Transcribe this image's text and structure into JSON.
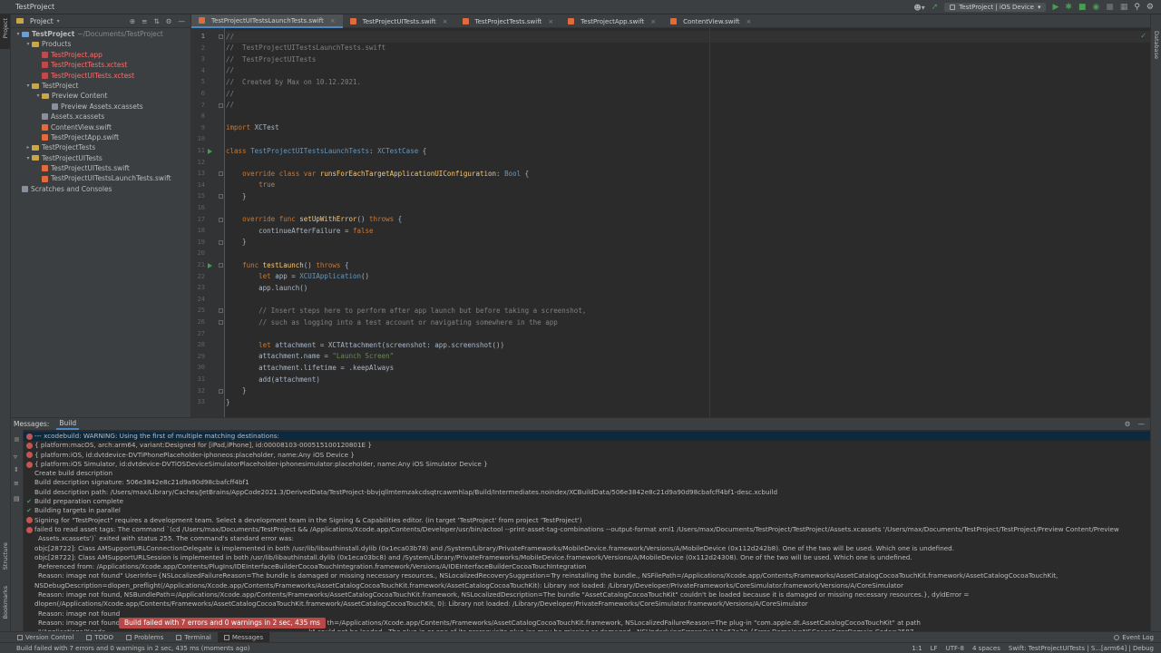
{
  "window": {
    "title": "TestProject"
  },
  "toolbar": {
    "run_config": "TestProject | iOS Device"
  },
  "project_panel": {
    "title": "Project",
    "tree": [
      {
        "depth": 0,
        "kind": "root",
        "label": "TestProject",
        "extra": "~/Documents/TestProject",
        "open": true
      },
      {
        "depth": 1,
        "kind": "folder",
        "label": "Products",
        "open": true
      },
      {
        "depth": 2,
        "kind": "red",
        "label": "TestProject.app"
      },
      {
        "depth": 2,
        "kind": "red",
        "label": "TestProjectTests.xctest"
      },
      {
        "depth": 2,
        "kind": "red",
        "label": "TestProjectUITests.xctest"
      },
      {
        "depth": 1,
        "kind": "folder",
        "label": "TestProject",
        "open": true
      },
      {
        "depth": 2,
        "kind": "folder",
        "label": "Preview Content",
        "open": true
      },
      {
        "depth": 3,
        "kind": "asset",
        "label": "Preview Assets.xcassets"
      },
      {
        "depth": 2,
        "kind": "asset",
        "label": "Assets.xcassets"
      },
      {
        "depth": 2,
        "kind": "swift",
        "label": "ContentView.swift"
      },
      {
        "depth": 2,
        "kind": "swift",
        "label": "TestProjectApp.swift"
      },
      {
        "depth": 1,
        "kind": "folder",
        "label": "TestProjectTests",
        "open": false
      },
      {
        "depth": 1,
        "kind": "folder",
        "label": "TestProjectUITests",
        "open": true
      },
      {
        "depth": 2,
        "kind": "swift",
        "label": "TestProjectUITests.swift"
      },
      {
        "depth": 2,
        "kind": "swift",
        "label": "TestProjectUITestsLaunchTests.swift"
      },
      {
        "depth": 0,
        "kind": "scratch",
        "label": "Scratches and Consoles"
      }
    ]
  },
  "tabs": [
    {
      "label": "TestProjectUITestsLaunchTests.swift",
      "active": true
    },
    {
      "label": "TestProjectUITests.swift",
      "active": false
    },
    {
      "label": "TestProjectTests.swift",
      "active": false
    },
    {
      "label": "TestProjectApp.swift",
      "active": false
    },
    {
      "label": "ContentView.swift",
      "active": false
    }
  ],
  "editor": {
    "lines": [
      [
        [
          "cm",
          "//"
        ]
      ],
      [
        [
          "cm",
          "//  TestProjectUITestsLaunchTests.swift"
        ]
      ],
      [
        [
          "cm",
          "//  TestProjectUITests"
        ]
      ],
      [
        [
          "cm",
          "//"
        ]
      ],
      [
        [
          "cm",
          "//  Created by Max on 10.12.2021."
        ]
      ],
      [
        [
          "cm",
          "//"
        ]
      ],
      [
        [
          "cm",
          "//"
        ]
      ],
      [],
      [
        [
          "kw",
          "import "
        ],
        [
          "ty",
          "XCTest"
        ]
      ],
      [],
      [
        [
          "kw",
          "class "
        ],
        [
          "cls",
          "TestProjectUITestsLaunchTests"
        ],
        [
          "ty",
          ": "
        ],
        [
          "cls",
          "XCTestCase"
        ],
        [
          "ty",
          " {"
        ]
      ],
      [],
      [
        [
          "ty",
          "    "
        ],
        [
          "kw",
          "override class var "
        ],
        [
          "fn",
          "runsForEachTargetApplicationUIConfiguration"
        ],
        [
          "ty",
          ": "
        ],
        [
          "cls",
          "Bool"
        ],
        [
          "ty",
          " {"
        ]
      ],
      [
        [
          "ty",
          "        "
        ],
        [
          "kw",
          "true"
        ]
      ],
      [
        [
          "ty",
          "    }"
        ]
      ],
      [],
      [
        [
          "ty",
          "    "
        ],
        [
          "kw",
          "override func "
        ],
        [
          "fn",
          "setUpWithError"
        ],
        [
          "ty",
          "() "
        ],
        [
          "kw",
          "throws"
        ],
        [
          "ty",
          " {"
        ]
      ],
      [
        [
          "ty",
          "        continueAfterFailure = "
        ],
        [
          "kw",
          "false"
        ]
      ],
      [
        [
          "ty",
          "    }"
        ]
      ],
      [],
      [
        [
          "ty",
          "    "
        ],
        [
          "kw",
          "func "
        ],
        [
          "fn",
          "testLaunch"
        ],
        [
          "ty",
          "() "
        ],
        [
          "kw",
          "throws"
        ],
        [
          "ty",
          " {"
        ]
      ],
      [
        [
          "ty",
          "        "
        ],
        [
          "kw",
          "let "
        ],
        [
          "ty",
          "app = "
        ],
        [
          "cls",
          "XCUIApplication"
        ],
        [
          "ty",
          "()"
        ]
      ],
      [
        [
          "ty",
          "        app.launch()"
        ]
      ],
      [],
      [
        [
          "ty",
          "        "
        ],
        [
          "cm",
          "// Insert steps here to perform after app launch but before taking a screenshot,"
        ]
      ],
      [
        [
          "ty",
          "        "
        ],
        [
          "cm",
          "// such as logging into a test account or navigating somewhere in the app"
        ]
      ],
      [],
      [
        [
          "ty",
          "        "
        ],
        [
          "kw",
          "let "
        ],
        [
          "ty",
          "attachment = XCTAttachment(screenshot: app.screenshot())"
        ]
      ],
      [
        [
          "ty",
          "        attachment.name = "
        ],
        [
          "str",
          "\"Launch Screen\""
        ]
      ],
      [
        [
          "ty",
          "        attachment.lifetime = .keepAlways"
        ]
      ],
      [
        [
          "ty",
          "        add(attachment)"
        ]
      ],
      [
        [
          "ty",
          "    }"
        ]
      ],
      [
        [
          "ty",
          "}"
        ]
      ]
    ]
  },
  "messages_panel": {
    "title": "Messages:",
    "tab": "Build",
    "messages": [
      {
        "icon": "error",
        "text": "--- xcodebuild: WARNING: Using the first of multiple matching destinations:",
        "selected": true
      },
      {
        "icon": "error",
        "text": "{ platform:macOS, arch:arm64, variant:Designed for [iPad,iPhone], id:00008103-000515100120801E }"
      },
      {
        "icon": "error",
        "text": "{ platform:iOS, id:dvtdevice-DVTiPhonePlaceholder-iphoneos:placeholder, name:Any iOS Device }"
      },
      {
        "icon": "error",
        "text": "{ platform:iOS Simulator, id:dvtdevice-DVTiOSDeviceSimulatorPlaceholder-iphonesimulator:placeholder, name:Any iOS Simulator Device }"
      },
      {
        "icon": "none",
        "text": "Create build description"
      },
      {
        "icon": "none",
        "text": "Build description signature: 506e3842e8c21d9a90d98cbafcff4bf1"
      },
      {
        "icon": "none",
        "text": "Build description path: /Users/max/Library/Caches/JetBrains/AppCode2021.3/DerivedData/TestProject-bbvjqllmtemzakcdsqtrcawmhlap/Build/Intermediates.noindex/XCBuildData/506e3842e8c21d9a90d98cbafcff4bf1-desc.xcbuild"
      },
      {
        "icon": "ok",
        "text": "Build preparation complete"
      },
      {
        "icon": "ok",
        "text": "Building targets in parallel"
      },
      {
        "icon": "error",
        "text": "Signing for \"TestProject\" requires a development team. Select a development team in the Signing & Capabilities editor. (in target 'TestProject' from project 'TestProject')"
      },
      {
        "icon": "error",
        "text": "failed to read asset tags: The command `(cd /Users/max/Documents/TestProject && /Applications/Xcode.app/Contents/Developer/usr/bin/actool --print-asset-tag-combinations --output-format xml1 /Users/max/Documents/TestProject/TestProject/Assets.xcassets '/Users/max/Documents/TestProject/TestProject/Preview Content/Preview"
      },
      {
        "icon": "none",
        "text": "Assets.xcassets')` exited with status 255. The command's standard error was:",
        "indent": true
      },
      {
        "icon": "none",
        "text": "objc[28722]: Class AMSupportURLConnectionDelegate is implemented in both /usr/lib/libauthinstall.dylib (0x1eca03b78) and /System/Library/PrivateFrameworks/MobileDevice.framework/Versions/A/MobileDevice (0x112d242b8). One of the two will be used. Which one is undefined."
      },
      {
        "icon": "none",
        "text": "objc[28722]: Class AMSupportURLSession is implemented in both /usr/lib/libauthinstall.dylib (0x1eca03bc8) and /System/Library/PrivateFrameworks/MobileDevice.framework/Versions/A/MobileDevice (0x112d24308). One of the two will be used. Which one is undefined."
      },
      {
        "icon": "none",
        "text": "Referenced from: /Applications/Xcode.app/Contents/PlugIns/IDEInterfaceBuilderCocoaTouchIntegration.framework/Versions/A/IDEInterfaceBuilderCocoaTouchIntegration",
        "indent": true
      },
      {
        "icon": "none",
        "text": "Reason: image not found\" UserInfo={NSLocalizedFailureReason=The bundle is damaged or missing necessary resources., NSLocalizedRecoverySuggestion=Try reinstalling the bundle., NSFilePath=/Applications/Xcode.app/Contents/Frameworks/AssetCatalogCocoaTouchKit.framework/AssetCatalogCocoaTouchKit,",
        "indent": true
      },
      {
        "icon": "none",
        "text": "NSDebugDescription=dlopen_preflight(/Applications/Xcode.app/Contents/Frameworks/AssetCatalogCocoaTouchKit.framework/AssetCatalogCocoaTouchKit): Library not loaded: /Library/Developer/PrivateFrameworks/CoreSimulator.framework/Versions/A/CoreSimulator"
      },
      {
        "icon": "none",
        "text": "Reason: image not found, NSBundlePath=/Applications/Xcode.app/Contents/Frameworks/AssetCatalogCocoaTouchKit.framework, NSLocalizedDescription=The bundle \"AssetCatalogCocoaTouchKit\" couldn't be loaded because it is damaged or missing necessary resources.}, dyldError =",
        "indent": true
      },
      {
        "icon": "none",
        "text": "dlopen(/Applications/Xcode.app/Contents/Frameworks/AssetCatalogCocoaTouchKit.framework/AssetCatalogCocoaTouchKit, 0): Library not loaded: /Library/Developer/PrivateFrameworks/CoreSimulator.framework/Versions/A/CoreSimulator"
      },
      {
        "icon": "none",
        "text": "Reason: image not found",
        "indent": true
      },
      {
        "icon": "none",
        "text": "Reason: image not found                                                                                                    th=/Applications/Xcode.app/Contents/Frameworks/AssetCatalogCocoaTouchKit.framework, NSLocalizedFailureReason=The plug-in \"com.apple.dt.AssetCatalogCocoaTouchKit\" at path",
        "indent": true
      },
      {
        "icon": "none",
        "text": "\"/Applications/Xcode                                                                                                  k\" could not be loaded.  The plug-in or one of its prerequisite plug-ins may be missing or damaged., NSUnderlyingError=0x113e62a20 {Error Domain=NSCocoaErrorDomain Code=3587",
        "indent": true
      }
    ],
    "tooltip": "Build failed with 7 errors and 0 warnings in 2 sec, 435 ms"
  },
  "bottom_tools": {
    "items": [
      {
        "label": "Version Control",
        "name": "version-control"
      },
      {
        "label": "TODO",
        "name": "todo"
      },
      {
        "label": "Problems",
        "name": "problems"
      },
      {
        "label": "Terminal",
        "name": "terminal"
      },
      {
        "label": "Messages",
        "name": "messages",
        "active": true
      }
    ],
    "event_log": "Event Log"
  },
  "side_labels": {
    "project": "Project",
    "structure": "Structure",
    "bookmarks": "Bookmarks",
    "database": "Database"
  },
  "status": {
    "message": "Build failed with 7 errors and 0 warnings in 2 sec, 435 ms (moments ago)",
    "position": "1:1",
    "line_sep": "LF",
    "encoding": "UTF-8",
    "indent": "4 spaces",
    "context": "Swift: TestProjectUITests | S...[arm64] | Debug"
  },
  "colors": {
    "accent": "#4a88c7",
    "error": "#c75450",
    "success": "#499c54",
    "tooltip_bg": "#b94846"
  }
}
